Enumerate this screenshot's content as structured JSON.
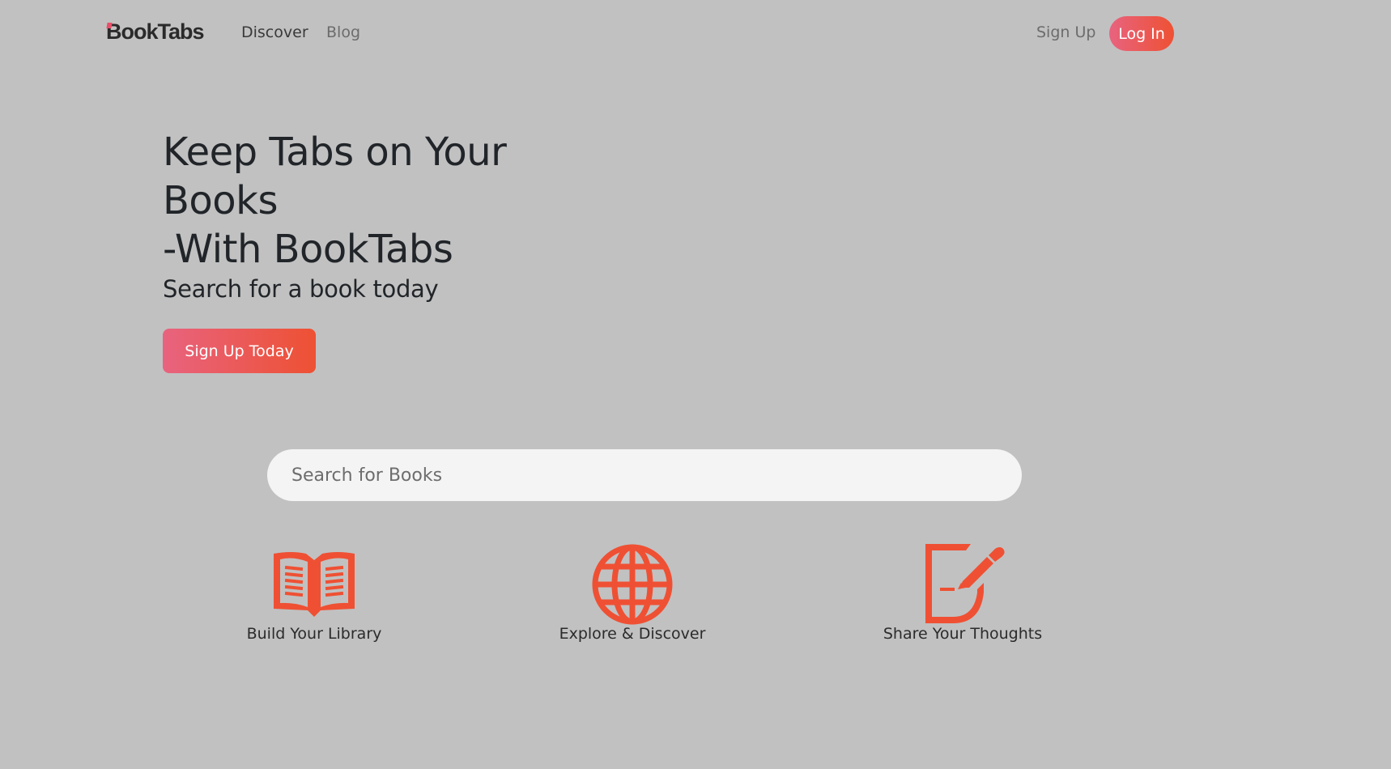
{
  "navbar": {
    "brand": "BookTabs",
    "links": [
      {
        "label": "Discover",
        "active": true
      },
      {
        "label": "Blog",
        "active": false
      }
    ],
    "signup_label": "Sign Up",
    "login_label": "Log In"
  },
  "hero": {
    "title_lines": [
      "Keep Tabs on Your",
      "Books",
      "-With BookTabs"
    ],
    "subtitle": "Search for a book today",
    "cta_label": "Sign Up Today"
  },
  "search": {
    "placeholder": "Search for Books",
    "value": ""
  },
  "features": [
    {
      "icon": "open-book-icon",
      "label": "Build Your Library"
    },
    {
      "icon": "globe-icon",
      "label": "Explore & Discover"
    },
    {
      "icon": "pen-paper-icon",
      "label": "Share Your Thoughts"
    }
  ],
  "colors": {
    "background": "#c1c1c1",
    "accent": "#ef5033",
    "gradient_start": "#e8637f",
    "gradient_end": "#ee5133",
    "search_bg": "#f4f4f4"
  }
}
